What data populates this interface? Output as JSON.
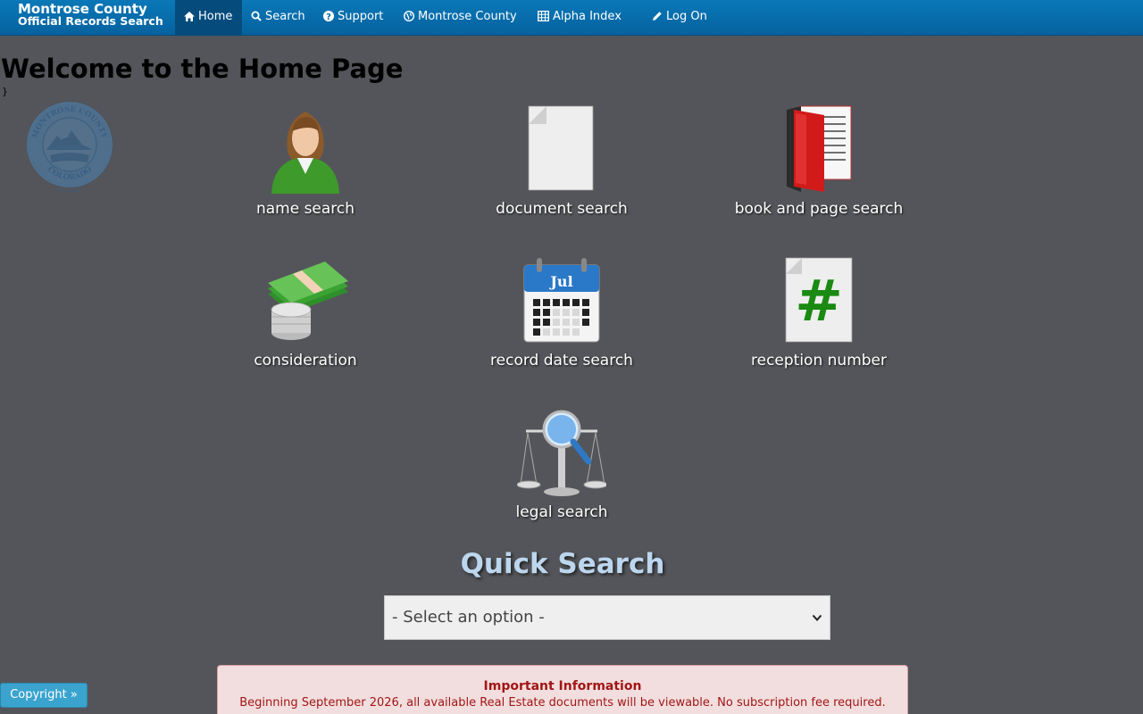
{
  "brand": {
    "line1": "Montrose County",
    "line2": "Official Records Search"
  },
  "nav": {
    "home": "Home",
    "search": "Search",
    "support": "Support",
    "county": "Montrose County",
    "alpha": "Alpha Index",
    "logon": "Log On"
  },
  "page": {
    "title": "Welcome to the Home Page",
    "stray": "}"
  },
  "seal": {
    "top_text": "MONTROSE COUNTY",
    "bottom_text": "COLORADO",
    "est": "EST. 1883"
  },
  "tiles": {
    "name": "name search",
    "document": "document search",
    "book": "book and page search",
    "consideration": "consideration",
    "record_date": "record date search",
    "reception": "reception number",
    "legal": "legal search"
  },
  "calendar": {
    "month": "Jul"
  },
  "reception_glyph": "#",
  "quick_search": {
    "title": "Quick Search",
    "selected": "- Select an option -"
  },
  "info": {
    "title": "Important Information",
    "message": "Beginning September 2026, all available Real Estate documents will be viewable. No subscription fee required."
  },
  "copyright": "Copyright »",
  "colors": {
    "nav": "#0a6fad",
    "accent": "#3aa4cf",
    "quick_search": "#bcd6ee"
  }
}
